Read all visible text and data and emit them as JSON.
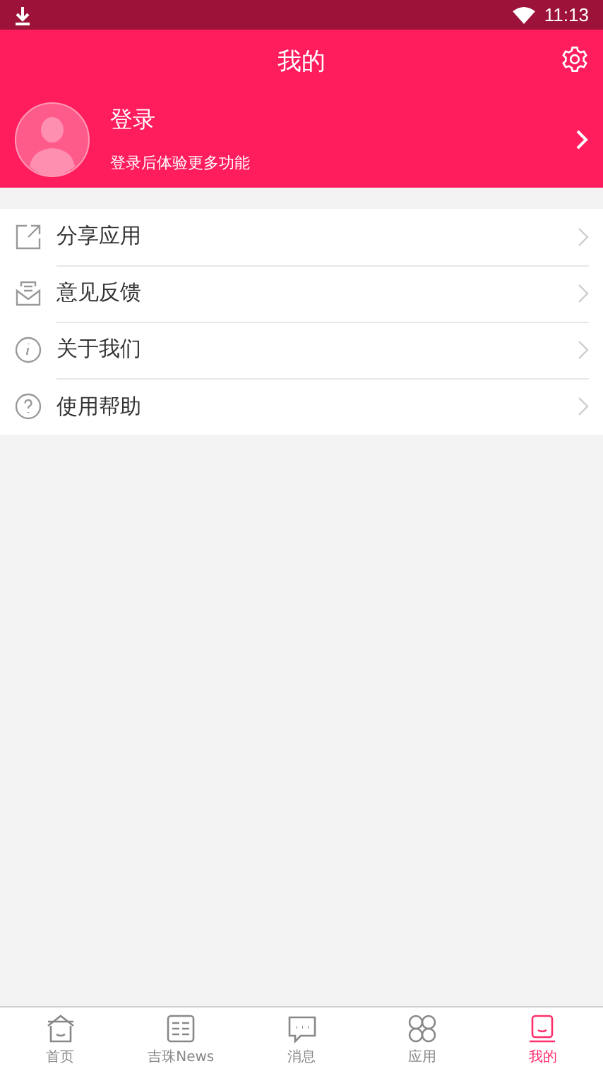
{
  "status_bar": {
    "time": "11:13"
  },
  "header": {
    "title": "我的",
    "login": {
      "title": "登录",
      "subtitle": "登录后体验更多功能"
    }
  },
  "menu": [
    {
      "kind": "share",
      "label": "分享应用"
    },
    {
      "kind": "feedback",
      "label": "意见反馈"
    },
    {
      "kind": "about",
      "label": "关于我们"
    },
    {
      "kind": "help",
      "label": "使用帮助"
    }
  ],
  "tabs": [
    {
      "kind": "home",
      "label": "首页",
      "selected": false
    },
    {
      "kind": "news",
      "label": "吉珠News",
      "selected": false
    },
    {
      "kind": "message",
      "label": "消息",
      "selected": false
    },
    {
      "kind": "apps",
      "label": "应用",
      "selected": false
    },
    {
      "kind": "me",
      "label": "我的",
      "selected": true
    }
  ]
}
